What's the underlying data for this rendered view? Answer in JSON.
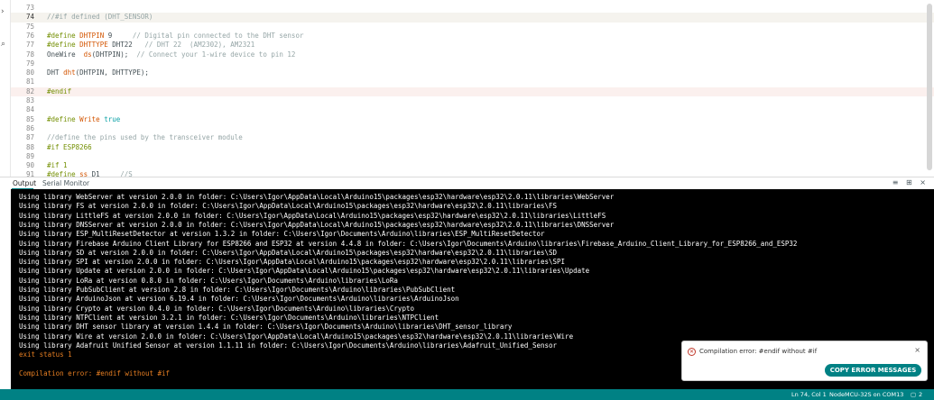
{
  "editor": {
    "lines": [
      {
        "n": "73",
        "parts": [
          {
            "t": "",
            "c": ""
          }
        ]
      },
      {
        "n": "74",
        "parts": [
          {
            "t": "//#if defined (DHT_SENSOR)",
            "c": "c-cm"
          }
        ]
      },
      {
        "n": "75",
        "parts": [
          {
            "t": "",
            "c": ""
          }
        ]
      },
      {
        "n": "76",
        "parts": [
          {
            "t": "#define ",
            "c": "c-pp"
          },
          {
            "t": "DHTPIN",
            "c": "c-fn"
          },
          {
            "t": " 9     ",
            "c": ""
          },
          {
            "t": "// Digital pin connected to the DHT sensor",
            "c": "c-cm"
          }
        ]
      },
      {
        "n": "77",
        "parts": [
          {
            "t": "#define ",
            "c": "c-pp"
          },
          {
            "t": "DHTTYPE",
            "c": "c-fn"
          },
          {
            "t": " DHT22   ",
            "c": ""
          },
          {
            "t": "// DHT 22  (AM2302), AM2321",
            "c": "c-cm"
          }
        ]
      },
      {
        "n": "78",
        "parts": [
          {
            "t": "OneWire  ",
            "c": ""
          },
          {
            "t": "ds",
            "c": "c-fn"
          },
          {
            "t": "(DHTPIN);  ",
            "c": ""
          },
          {
            "t": "// Connect your 1-wire device to pin 12",
            "c": "c-cm"
          }
        ]
      },
      {
        "n": "79",
        "parts": [
          {
            "t": "",
            "c": ""
          }
        ]
      },
      {
        "n": "80",
        "parts": [
          {
            "t": "DHT ",
            "c": ""
          },
          {
            "t": "dht",
            "c": "c-fn"
          },
          {
            "t": "(DHTPIN, DHTTYPE);",
            "c": ""
          }
        ]
      },
      {
        "n": "81",
        "parts": [
          {
            "t": "",
            "c": ""
          }
        ]
      },
      {
        "n": "82",
        "parts": [
          {
            "t": "#endif",
            "c": "c-pp"
          }
        ]
      },
      {
        "n": "83",
        "parts": [
          {
            "t": "",
            "c": ""
          }
        ]
      },
      {
        "n": "84",
        "parts": [
          {
            "t": "",
            "c": ""
          }
        ]
      },
      {
        "n": "85",
        "parts": [
          {
            "t": "#define ",
            "c": "c-pp"
          },
          {
            "t": "Write",
            "c": "c-fn"
          },
          {
            "t": " true",
            "c": "c-kw"
          }
        ]
      },
      {
        "n": "86",
        "parts": [
          {
            "t": "",
            "c": ""
          }
        ]
      },
      {
        "n": "87",
        "parts": [
          {
            "t": "//define the pins used by the transceiver module",
            "c": "c-cm"
          }
        ]
      },
      {
        "n": "88",
        "parts": [
          {
            "t": "#if ESP8266",
            "c": "c-pp"
          }
        ]
      },
      {
        "n": "89",
        "parts": [
          {
            "t": "",
            "c": ""
          }
        ]
      },
      {
        "n": "90",
        "parts": [
          {
            "t": "#if 1",
            "c": "c-pp"
          }
        ]
      },
      {
        "n": "91",
        "parts": [
          {
            "t": "#define ",
            "c": "c-pp"
          },
          {
            "t": "ss",
            "c": "c-fn"
          },
          {
            "t": " D1     ",
            "c": ""
          },
          {
            "t": "//S",
            "c": "c-cm"
          }
        ]
      }
    ]
  },
  "panel": {
    "tabs": [
      {
        "label": "Output"
      },
      {
        "label": "Serial Monitor"
      }
    ],
    "actions": "≡ ⊞ ⨯"
  },
  "output": {
    "lines": [
      {
        "t": "Using library WebServer at version 2.0.0 in folder: C:\\Users\\Igor\\AppData\\Local\\Arduino15\\packages\\esp32\\hardware\\esp32\\2.0.11\\libraries\\WebServer",
        "err": false
      },
      {
        "t": "Using library FS at version 2.0.0 in folder: C:\\Users\\Igor\\AppData\\Local\\Arduino15\\packages\\esp32\\hardware\\esp32\\2.0.11\\libraries\\FS",
        "err": false
      },
      {
        "t": "Using library LittleFS at version 2.0.0 in folder: C:\\Users\\Igor\\AppData\\Local\\Arduino15\\packages\\esp32\\hardware\\esp32\\2.0.11\\libraries\\LittleFS",
        "err": false
      },
      {
        "t": "Using library DNSServer at version 2.0.0 in folder: C:\\Users\\Igor\\AppData\\Local\\Arduino15\\packages\\esp32\\hardware\\esp32\\2.0.11\\libraries\\DNSServer",
        "err": false
      },
      {
        "t": "Using library ESP_MultiResetDetector at version 1.3.2 in folder: C:\\Users\\Igor\\Documents\\Arduino\\libraries\\ESP_MultiResetDetector",
        "err": false
      },
      {
        "t": "Using library Firebase Arduino Client Library for ESP8266 and ESP32 at version 4.4.8 in folder: C:\\Users\\Igor\\Documents\\Arduino\\libraries\\Firebase_Arduino_Client_Library_for_ESP8266_and_ESP32",
        "err": false
      },
      {
        "t": "Using library SD at version 2.0.0 in folder: C:\\Users\\Igor\\AppData\\Local\\Arduino15\\packages\\esp32\\hardware\\esp32\\2.0.11\\libraries\\SD",
        "err": false
      },
      {
        "t": "Using library SPI at version 2.0.0 in folder: C:\\Users\\Igor\\AppData\\Local\\Arduino15\\packages\\esp32\\hardware\\esp32\\2.0.11\\libraries\\SPI",
        "err": false
      },
      {
        "t": "Using library Update at version 2.0.0 in folder: C:\\Users\\Igor\\AppData\\Local\\Arduino15\\packages\\esp32\\hardware\\esp32\\2.0.11\\libraries\\Update",
        "err": false
      },
      {
        "t": "Using library LoRa at version 0.8.0 in folder: C:\\Users\\Igor\\Documents\\Arduino\\libraries\\LoRa",
        "err": false
      },
      {
        "t": "Using library PubSubClient at version 2.8 in folder: C:\\Users\\Igor\\Documents\\Arduino\\libraries\\PubSubClient",
        "err": false
      },
      {
        "t": "Using library ArduinoJson at version 6.19.4 in folder: C:\\Users\\Igor\\Documents\\Arduino\\libraries\\ArduinoJson",
        "err": false
      },
      {
        "t": "Using library Crypto at version 0.4.0 in folder: C:\\Users\\Igor\\Documents\\Arduino\\libraries\\Crypto",
        "err": false
      },
      {
        "t": "Using library NTPClient at version 3.2.1 in folder: C:\\Users\\Igor\\Documents\\Arduino\\libraries\\NTPClient",
        "err": false
      },
      {
        "t": "Using library DHT sensor library at version 1.4.4 in folder: C:\\Users\\Igor\\Documents\\Arduino\\libraries\\DHT_sensor_library",
        "err": false
      },
      {
        "t": "Using library Wire at version 2.0.0 in folder: C:\\Users\\Igor\\AppData\\Local\\Arduino15\\packages\\esp32\\hardware\\esp32\\2.0.11\\libraries\\Wire",
        "err": false
      },
      {
        "t": "Using library Adafruit Unified Sensor at version 1.1.11 in folder: C:\\Users\\Igor\\Documents\\Arduino\\libraries\\Adafruit_Unified_Sensor",
        "err": false
      },
      {
        "t": "exit status 1",
        "err": true
      },
      {
        "t": "",
        "err": false
      },
      {
        "t": "Compilation error: #endif without #if",
        "err": true
      }
    ]
  },
  "toast": {
    "message": "Compilation error: #endif without #if",
    "button": "COPY ERROR MESSAGES",
    "icon": "error-circle-icon",
    "close": "×"
  },
  "status": {
    "position": "Ln 74, Col 1",
    "board": "NodeMCU-32S on COM13",
    "notifications": "2",
    "accent": "#008184"
  }
}
